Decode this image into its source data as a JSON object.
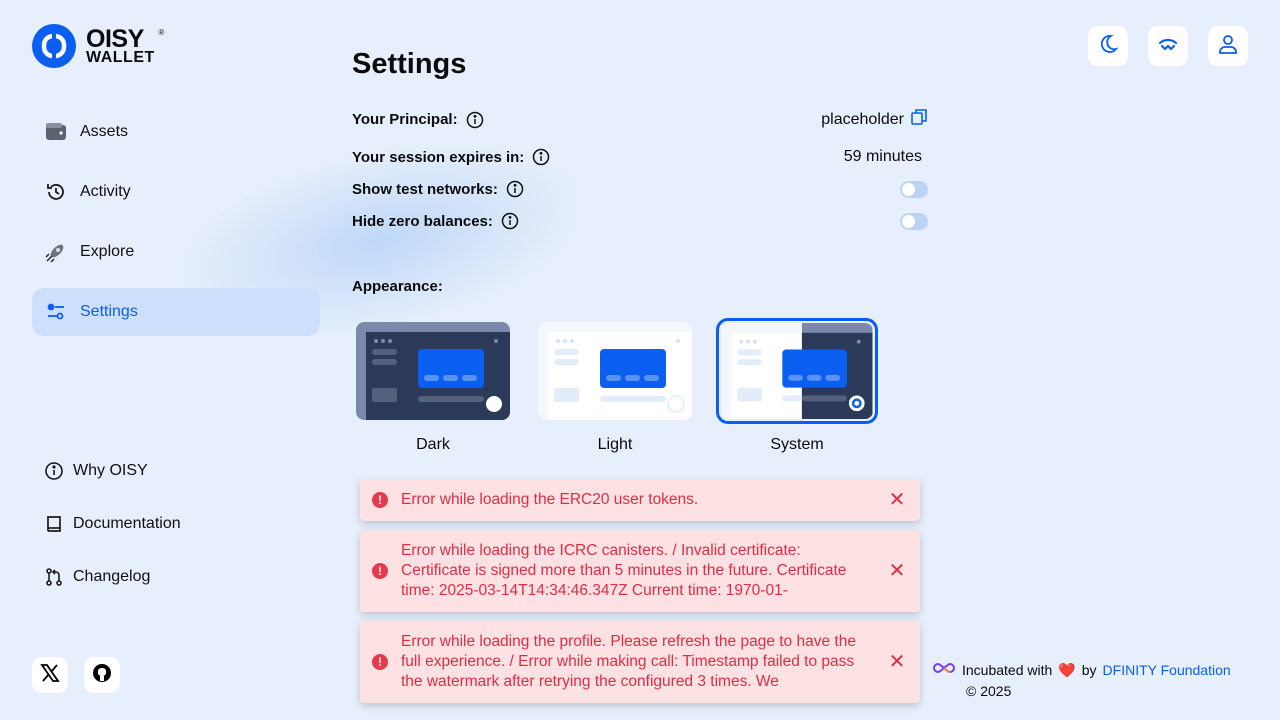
{
  "brand": {
    "line1": "OISY",
    "line2": "WALLET",
    "reg": "®"
  },
  "nav": {
    "items": [
      {
        "label": "Assets",
        "icon": "wallet-icon"
      },
      {
        "label": "Activity",
        "icon": "history-icon"
      },
      {
        "label": "Explore",
        "icon": "rocket-icon"
      },
      {
        "label": "Settings",
        "icon": "sliders-icon",
        "active": true
      }
    ],
    "bottom": [
      {
        "label": "Why OISY",
        "icon": "info-icon"
      },
      {
        "label": "Documentation",
        "icon": "book-icon"
      },
      {
        "label": "Changelog",
        "icon": "git-pull-request-icon"
      }
    ]
  },
  "socials": [
    "x-icon",
    "github-icon"
  ],
  "top_actions": [
    "moon-icon",
    "walletconnect-icon",
    "user-icon"
  ],
  "settings": {
    "title": "Settings",
    "principal_label": "Your Principal:",
    "principal_value": "placeholder",
    "session_label": "Your session expires in:",
    "session_value": "59 minutes",
    "test_networks_label": "Show test networks:",
    "hide_zero_label": "Hide zero balances:",
    "appearance_label": "Appearance:",
    "themes": [
      {
        "name": "Dark",
        "selected": false
      },
      {
        "name": "Light",
        "selected": false
      },
      {
        "name": "System",
        "selected": true
      }
    ]
  },
  "errors": [
    {
      "text": "Error while loading the ERC20 user tokens."
    },
    {
      "text": "Error while loading the ICRC canisters. / Invalid certificate: Certificate is signed more than 5 minutes in the future. Certificate time: 2025-03-14T14:34:46.347Z Current time: 1970-01-"
    },
    {
      "text": "Error while loading the profile. Please refresh the page to have the full experience. / Error while making call: Timestamp failed to pass the watermark after retrying the configured 3 times. We"
    }
  ],
  "footer": {
    "incubated": "Incubated with",
    "by": "by",
    "org": "DFINITY Foundation",
    "copyright": "© 2025"
  },
  "colors": {
    "accent": "#0a5ff0",
    "background": "#e6effb",
    "error": "#dc2f44"
  }
}
